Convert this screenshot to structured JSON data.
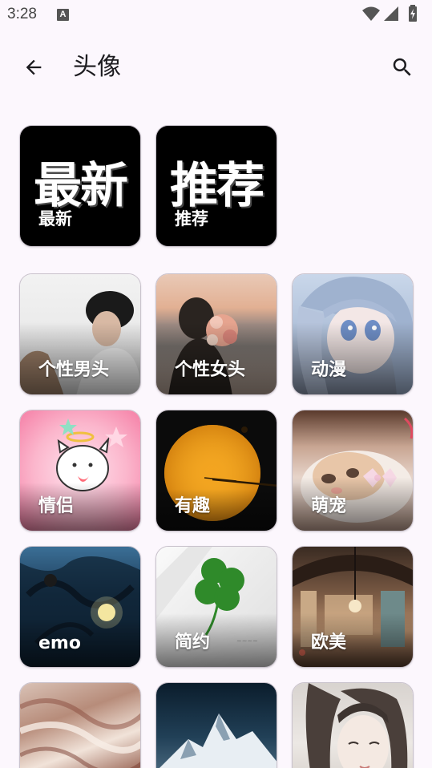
{
  "status": {
    "time": "3:28",
    "notification_icon": "A"
  },
  "header": {
    "title": "头像",
    "back_icon": "arrow-left-icon",
    "search_icon": "search-icon"
  },
  "featured": [
    {
      "big": "最新",
      "label": "最新"
    },
    {
      "big": "推荐",
      "label": "推荐"
    }
  ],
  "categories": [
    {
      "label": "个性男头"
    },
    {
      "label": "个性女头"
    },
    {
      "label": "动漫"
    },
    {
      "label": "情侣"
    },
    {
      "label": "有趣"
    },
    {
      "label": "萌宠"
    },
    {
      "label": "emo"
    },
    {
      "label": "简约"
    },
    {
      "label": "欧美"
    },
    {
      "label": ""
    },
    {
      "label": ""
    },
    {
      "label": ""
    }
  ],
  "colors": {
    "background": "#fcf7fd",
    "tile_border": "#c9c2cc"
  }
}
